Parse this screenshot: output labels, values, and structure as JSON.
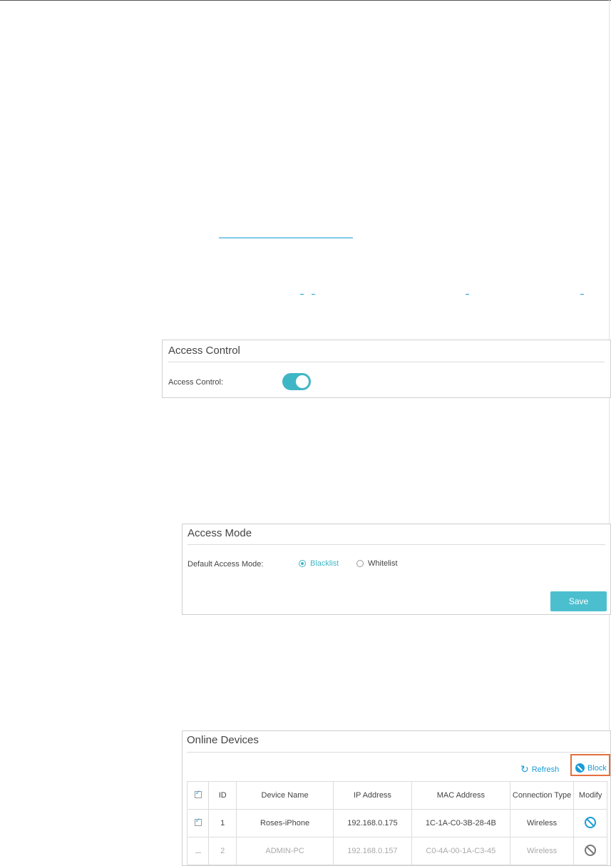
{
  "access_control": {
    "title": "Access Control",
    "label": "Access Control:",
    "toggle_on": true
  },
  "access_mode": {
    "title": "Access Mode",
    "label": "Default Access Mode:",
    "options": [
      "Blacklist",
      "Whitelist"
    ],
    "selected": "Blacklist",
    "save_label": "Save"
  },
  "online_devices": {
    "title": "Online Devices",
    "refresh_label": "Refresh",
    "block_label": "Block",
    "columns": [
      "ID",
      "Device Name",
      "IP Address",
      "MAC Address",
      "Connection Type",
      "Modify"
    ],
    "rows": [
      {
        "id": "1",
        "name": "Roses-iPhone",
        "ip": "192.168.0.175",
        "mac": "1C-1A-C0-3B-28-4B",
        "type": "Wireless",
        "checked": true
      },
      {
        "id": "2",
        "name": "ADMIN-PC",
        "ip": "192.168.0.157",
        "mac": "C0-4A-00-1A-C3-45",
        "type": "Wireless",
        "checked": false
      }
    ]
  },
  "colors": {
    "accent": "#3fb6c6",
    "link": "#1a9bd7",
    "highlight": "#e4703c"
  }
}
